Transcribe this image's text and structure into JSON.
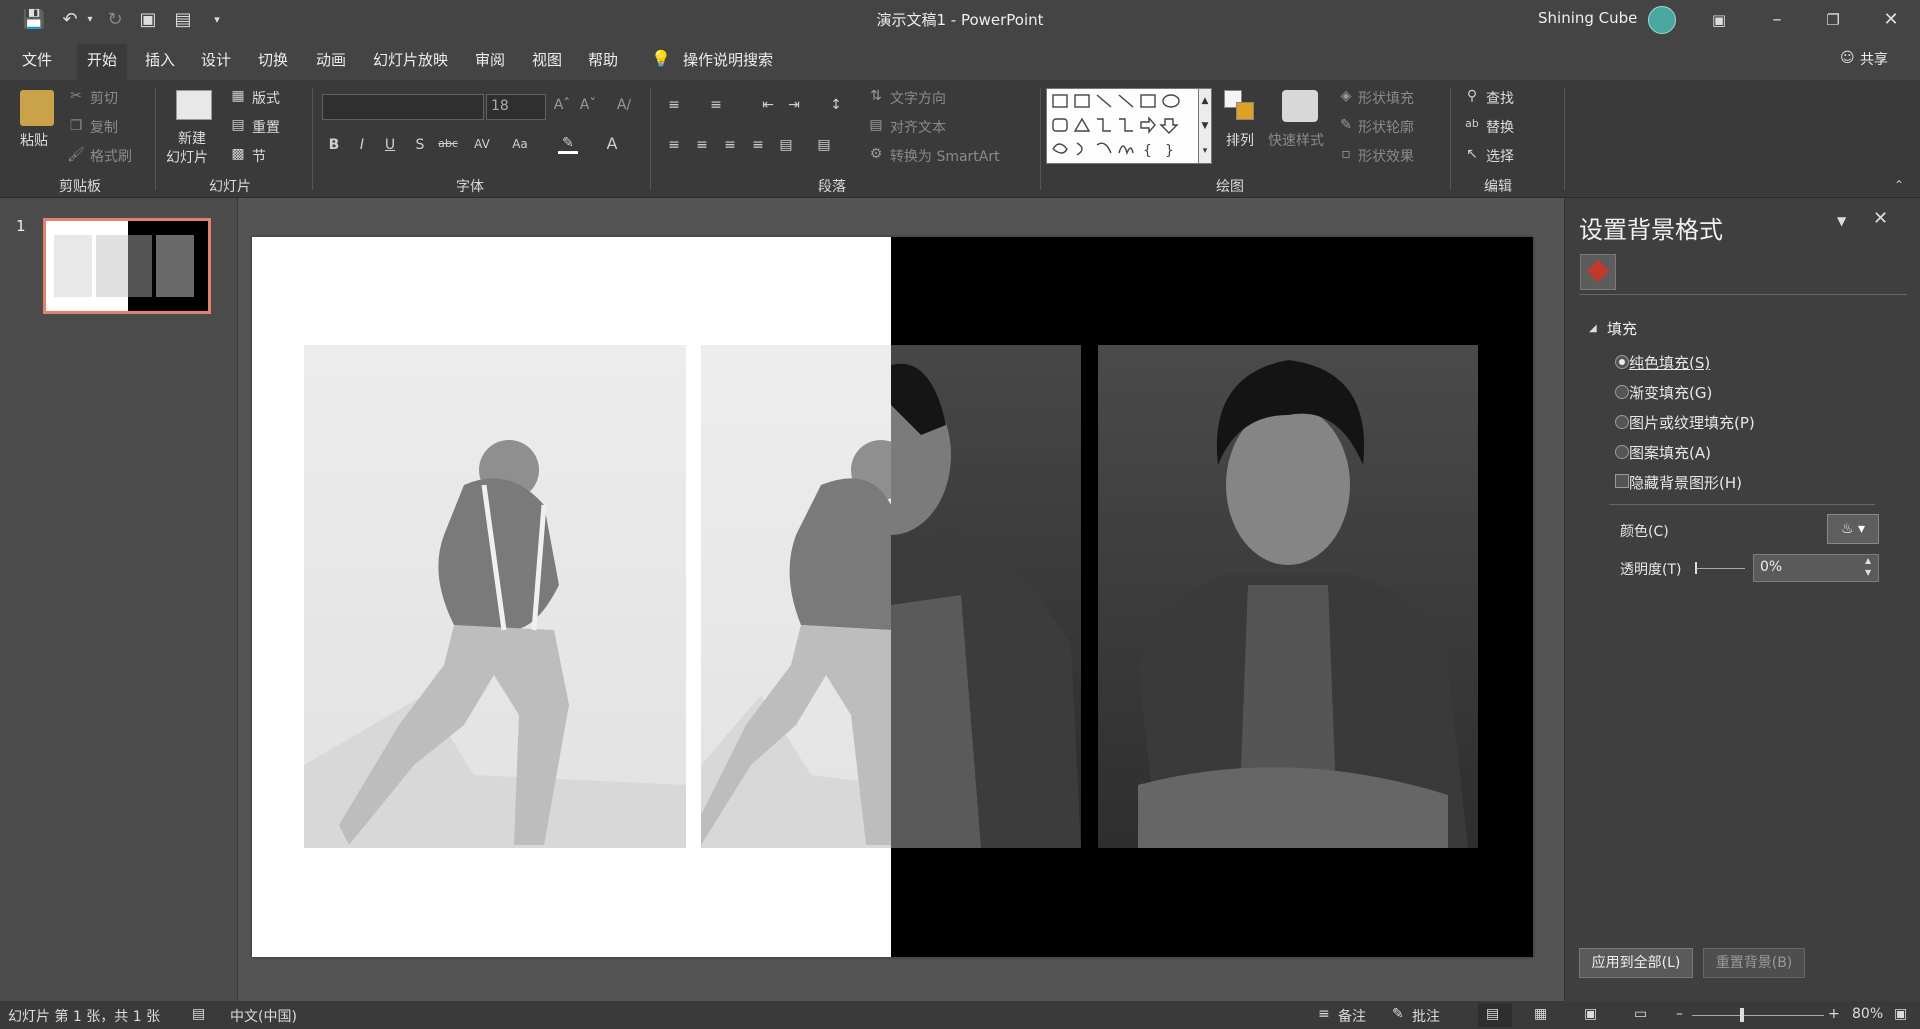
{
  "window": {
    "title": "演示文稿1  -  PowerPoint",
    "user": "Shining Cube"
  },
  "tabs": [
    "文件",
    "开始",
    "插入",
    "设计",
    "切换",
    "动画",
    "幻灯片放映",
    "审阅",
    "视图",
    "帮助"
  ],
  "tell_me": "操作说明搜索",
  "share": "共享",
  "ribbon": {
    "clipboard": {
      "paste": "粘贴",
      "cut": "剪切",
      "copy": "复制",
      "format_painter": "格式刷",
      "group": "剪贴板"
    },
    "slides": {
      "new_slide_1": "新建",
      "new_slide_2": "幻灯片",
      "layout": "版式",
      "reset": "重置",
      "section": "节",
      "group": "幻灯片"
    },
    "font": {
      "font_name": "",
      "font_size": "18",
      "group": "字体"
    },
    "paragraph": {
      "text_direction": "文字方向",
      "align_text": "对齐文本",
      "smartart": "转换为 SmartArt",
      "group": "段落"
    },
    "drawing": {
      "arrange": "排列",
      "quick_styles": "快速样式",
      "shape_fill": "形状填充",
      "shape_outline": "形状轮廓",
      "shape_effects": "形状效果",
      "group": "绘图"
    },
    "editing": {
      "find": "查找",
      "replace": "替换",
      "select": "选择",
      "group": "编辑"
    }
  },
  "thumbnails": [
    {
      "number": "1"
    }
  ],
  "format_pane": {
    "title": "设置背景格式",
    "section": "填充",
    "options": [
      {
        "label": "纯色填充(S)",
        "selected": true
      },
      {
        "label": "渐变填充(G)",
        "selected": false
      },
      {
        "label": "图片或纹理填充(P)",
        "selected": false
      },
      {
        "label": "图案填充(A)",
        "selected": false
      }
    ],
    "hide_bg": "隐藏背景图形(H)",
    "color_label": "颜色(C)",
    "transparency_label": "透明度(T)",
    "transparency_value": "0%",
    "apply_all": "应用到全部(L)",
    "reset_bg": "重置背景(B)"
  },
  "status": {
    "slide_info": "幻灯片 第 1 张，共 1 张",
    "language": "中文(中国)",
    "notes": "备注",
    "comments": "批注",
    "zoom": "80%"
  }
}
